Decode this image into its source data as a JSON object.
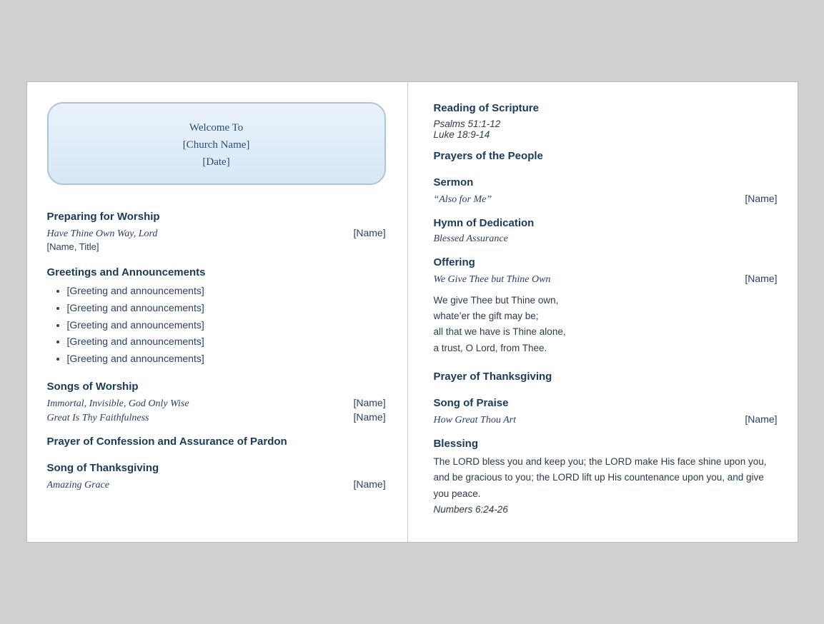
{
  "welcome": {
    "line1": "Welcome To",
    "line2": "[Church Name]",
    "line3": "[Date]"
  },
  "left": {
    "sections": [
      {
        "heading": "Preparing for Worship",
        "type": "song-with-sub",
        "song": "Have Thine Own Way, Lord",
        "assignee": "[Name]",
        "sublabel": "[Name, Title]"
      },
      {
        "heading": "Greetings and Announcements",
        "type": "bullets",
        "items": [
          "[Greeting and announcements]",
          "[Greeting and announcements]",
          "[Greeting and announcements]",
          "[Greeting and announcements]",
          "[Greeting and announcements]"
        ]
      },
      {
        "heading": "Songs of Worship",
        "type": "songs",
        "songs": [
          {
            "title": "Immortal, Invisible, God Only Wise",
            "assignee": "[Name]"
          },
          {
            "title": "Great Is Thy Faithfulness",
            "assignee": "[Name]"
          }
        ]
      },
      {
        "heading": "Prayer of Confession and Assurance of Pardon",
        "type": "heading-only"
      },
      {
        "heading": "Song of Thanksgiving",
        "type": "song-only",
        "song": "Amazing Grace",
        "assignee": "[Name]"
      }
    ]
  },
  "right": {
    "sections": [
      {
        "heading": "Reading of Scripture",
        "type": "scripture",
        "refs": [
          "Psalms 51:1-12",
          "Luke 18:9-14"
        ]
      },
      {
        "heading": "Prayers of the People",
        "type": "heading-only"
      },
      {
        "heading": "Sermon",
        "type": "song-only",
        "song": "“Also for Me”",
        "assignee": "[Name]"
      },
      {
        "heading": "Hymn of Dedication",
        "type": "song-no-assignee",
        "song": "Blessed Assurance"
      },
      {
        "heading": "Offering",
        "type": "offering",
        "song": "We Give Thee but Thine Own",
        "assignee": "[Name]",
        "verse_lines": [
          "We give Thee but Thine own,",
          "whate’er the gift may be;",
          "all that we have is Thine alone,",
          "a trust, O Lord, from Thee."
        ]
      },
      {
        "heading": "Prayer of Thanksgiving",
        "type": "heading-only"
      },
      {
        "heading": "Song of Praise",
        "type": "song-only",
        "song": "How Great Thou Art",
        "assignee": "[Name]"
      },
      {
        "heading": "Blessing",
        "type": "blessing",
        "text": "The LORD bless you and keep you; the LORD make His face shine upon you, and be gracious to you; the LORD lift up His countenance upon you, and give you peace.",
        "ref": "Numbers 6:24-26"
      }
    ]
  }
}
